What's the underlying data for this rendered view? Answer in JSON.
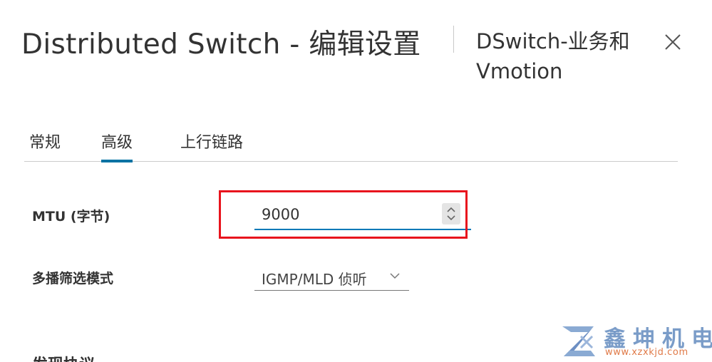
{
  "dialog": {
    "title": "Distributed Switch - 编辑设置",
    "subtitle": "DSwitch-业务和 Vmotion",
    "close_icon": "close-icon"
  },
  "tabs": [
    {
      "label": "常规",
      "active": false
    },
    {
      "label": "高级",
      "active": true
    },
    {
      "label": "上行链路",
      "active": false
    }
  ],
  "fields": {
    "mtu": {
      "label": "MTU (字节)",
      "value": "9000"
    },
    "multicast_filter": {
      "label": "多播筛选模式",
      "value": "IGMP/MLD 侦听"
    }
  },
  "next_section": {
    "label": "发现协议"
  },
  "watermark": {
    "name": "鑫坤机电",
    "url": "www.xzxkjd.com"
  },
  "colors": {
    "accent": "#0072a3",
    "highlight_box": "#e8141d",
    "watermark_blue": "#7a9cc8",
    "watermark_orange": "#e07a48"
  }
}
